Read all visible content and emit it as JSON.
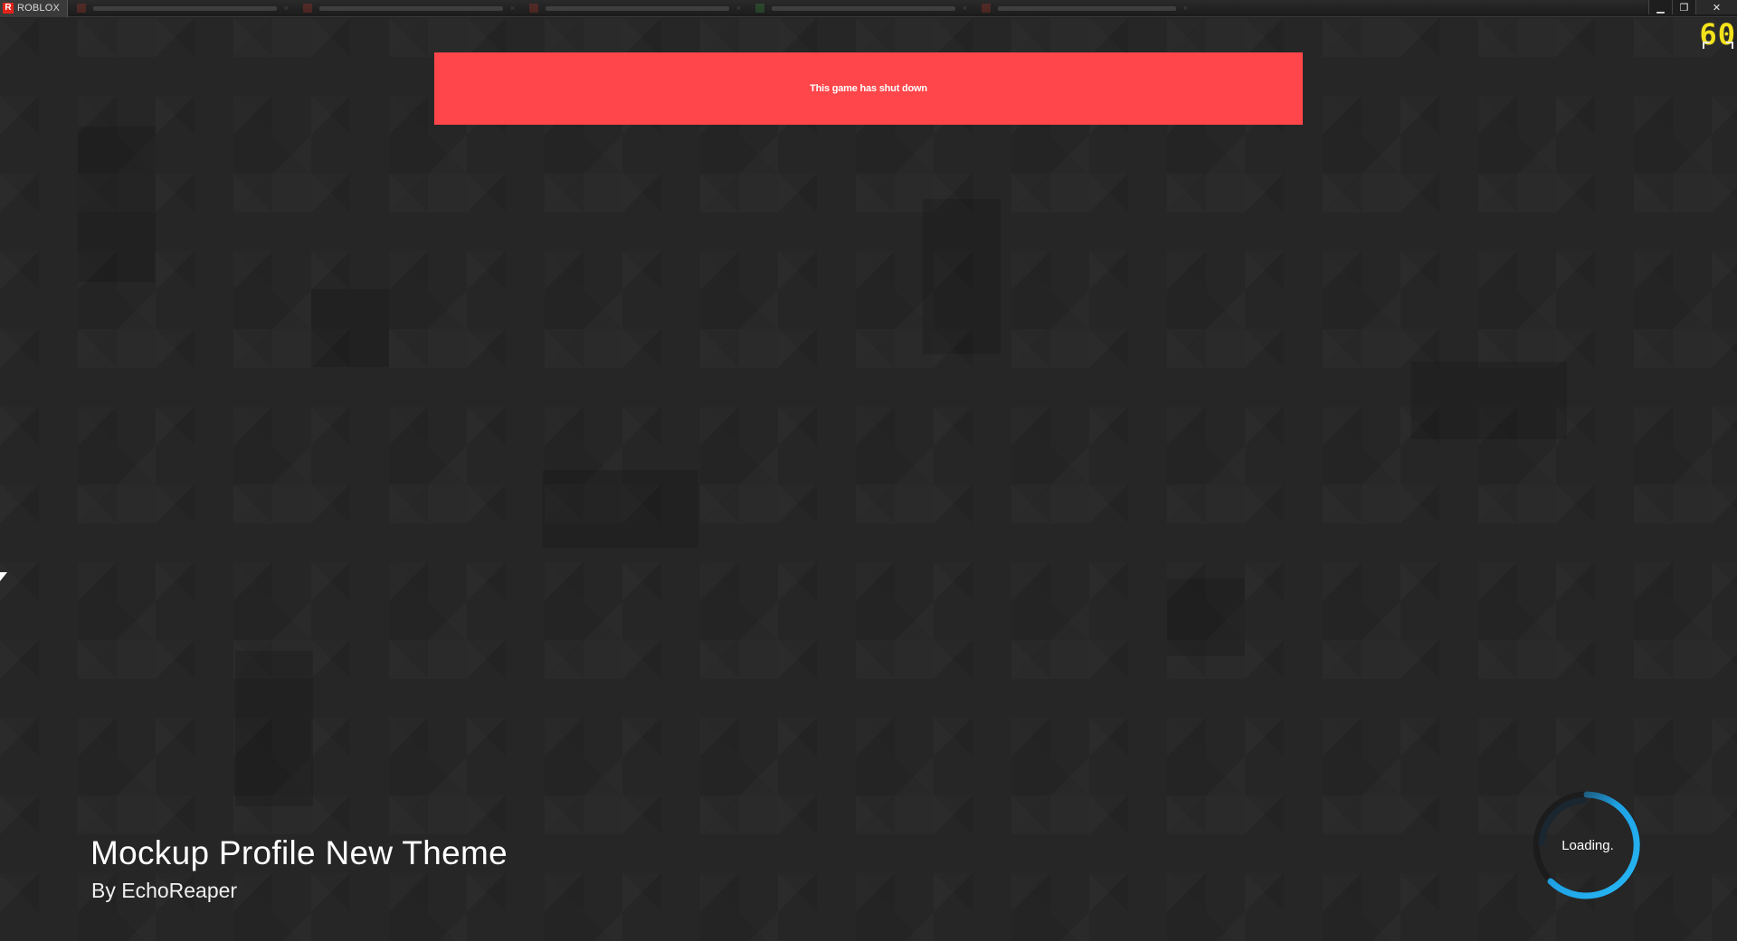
{
  "window": {
    "app_name": "ROBLOX",
    "controls": {
      "minimize": "▁",
      "restore": "❐",
      "close": "✕"
    }
  },
  "fps": {
    "value": "60"
  },
  "banner": {
    "message": "This game has shut down",
    "color": "#ff464a"
  },
  "game": {
    "title": "Mockup Profile New Theme",
    "author": "By EchoReaper"
  },
  "loader": {
    "label": "Loading.",
    "accent_color": "#1fa3e6"
  }
}
